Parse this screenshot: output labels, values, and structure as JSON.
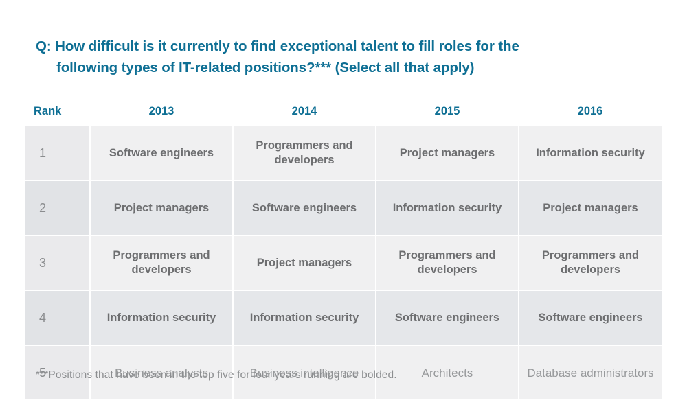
{
  "title": {
    "line1": "Q: How difficult is it currently to find exceptional talent to fill roles for the",
    "line2": "following types of IT-related positions?*** (Select all that apply)"
  },
  "footnote": "***Positions that have been in the top five for four years running are bolded.",
  "colors": {
    "title_teal": "#0e6f94",
    "header_teal": "#0e6f94",
    "cell_text": "#6d6e70",
    "cell_text_light": "#97999b",
    "rank_text": "#8a8c8e",
    "row_odd_bg": "#f0f0f1",
    "row_even_bg": "#e5e7ea",
    "rank_odd_bg": "#eaeaec",
    "rank_even_bg": "#e1e3e6",
    "page_bg": "#ffffff"
  },
  "chart_data": {
    "type": "table",
    "title": "Q: How difficult is it currently to find exceptional talent to fill roles for the following types of IT-related positions?*** (Select all that apply)",
    "columns": [
      "Rank",
      "2013",
      "2014",
      "2015",
      "2016"
    ],
    "rows": [
      {
        "rank": "1",
        "y2013": "Software engineers",
        "y2014": "Programmers and developers",
        "y2015": "Project managers",
        "y2016": "Information security",
        "bold": true
      },
      {
        "rank": "2",
        "y2013": "Project managers",
        "y2014": "Software engineers",
        "y2015": "Information security",
        "y2016": "Project managers",
        "bold": true
      },
      {
        "rank": "3",
        "y2013": "Programmers and developers",
        "y2014": "Project managers",
        "y2015": "Programmers and developers",
        "y2016": "Programmers and developers",
        "bold": true
      },
      {
        "rank": "4",
        "y2013": "Information security",
        "y2014": "Information security",
        "y2015": "Software engineers",
        "y2016": "Software engineers",
        "bold": true
      },
      {
        "rank": "5",
        "y2013": "Business analysts",
        "y2014": "Business intelligence",
        "y2015": "Architects",
        "y2016": "Database administrators",
        "bold": false
      }
    ],
    "annotations": [
      "***Positions that have been in the top five for four years running are bolded."
    ]
  },
  "table": {
    "headers": {
      "rank": "Rank",
      "y2013": "2013",
      "y2014": "2014",
      "y2015": "2015",
      "y2016": "2016"
    },
    "rows": [
      {
        "rank": "1",
        "y2013": "Software engineers",
        "y2014": "Programmers and developers",
        "y2015": "Project managers",
        "y2016": "Information security"
      },
      {
        "rank": "2",
        "y2013": "Project managers",
        "y2014": "Software engineers",
        "y2015": "Information security",
        "y2016": "Project managers"
      },
      {
        "rank": "3",
        "y2013": "Programmers and developers",
        "y2014": "Project managers",
        "y2015": "Programmers and developers",
        "y2016": "Programmers and developers"
      },
      {
        "rank": "4",
        "y2013": "Information security",
        "y2014": "Information security",
        "y2015": "Software engineers",
        "y2016": "Software engineers"
      },
      {
        "rank": "5",
        "y2013": "Business analysts",
        "y2014": "Business intelligence",
        "y2015": "Architects",
        "y2016": "Database administrators"
      }
    ]
  }
}
